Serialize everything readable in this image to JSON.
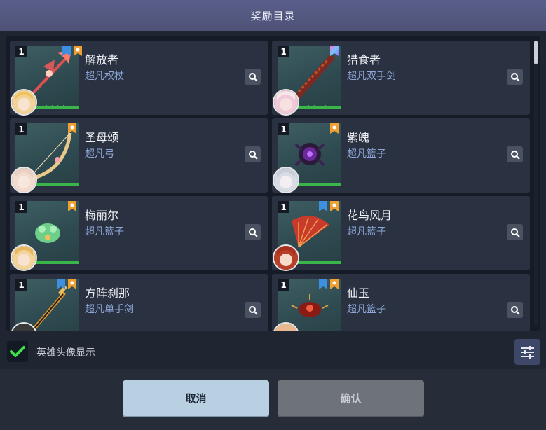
{
  "dialog": {
    "title": "奖励目录"
  },
  "rewards": [
    {
      "count": "1",
      "name": "解放者",
      "type": "超凡权杖",
      "stars": "★★★★",
      "badges": [
        "blue-tag-icon",
        "orange-tag-icon"
      ]
    },
    {
      "count": "1",
      "name": "猎食者",
      "type": "超凡双手剑",
      "stars": "★★★★",
      "badges": [
        "rainbow-tag-icon"
      ]
    },
    {
      "count": "1",
      "name": "圣母颂",
      "type": "超凡弓",
      "stars": "★★★★",
      "badges": [
        "orange-tag-icon"
      ]
    },
    {
      "count": "1",
      "name": "紫魄",
      "type": "超凡篮子",
      "stars": "★★★",
      "badges": [
        "orange-tag-icon"
      ]
    },
    {
      "count": "1",
      "name": "梅丽尔",
      "type": "超凡篮子",
      "stars": "★★★★",
      "badges": [
        "orange-tag-icon"
      ]
    },
    {
      "count": "1",
      "name": "花鸟风月",
      "type": "超凡篮子",
      "stars": "★★★★",
      "badges": [
        "blue-tag-icon",
        "orange-tag-icon"
      ]
    },
    {
      "count": "1",
      "name": "方阵刹那",
      "type": "超凡单手剑",
      "stars": "",
      "badges": [
        "blue-tag-icon",
        "orange-tag-icon"
      ]
    },
    {
      "count": "1",
      "name": "仙玉",
      "type": "超凡篮子",
      "stars": "",
      "badges": [
        "blue-tag-icon",
        "orange-tag-icon"
      ]
    }
  ],
  "options": {
    "show_hero_avatar_label": "英雄头像显示",
    "show_hero_avatar_checked": true
  },
  "footer": {
    "cancel_label": "取消",
    "confirm_label": "确认"
  },
  "colors": {
    "accent_green": "#39b54a",
    "title_bar": "#5a5f8a",
    "type_text": "#8ea8d8"
  }
}
